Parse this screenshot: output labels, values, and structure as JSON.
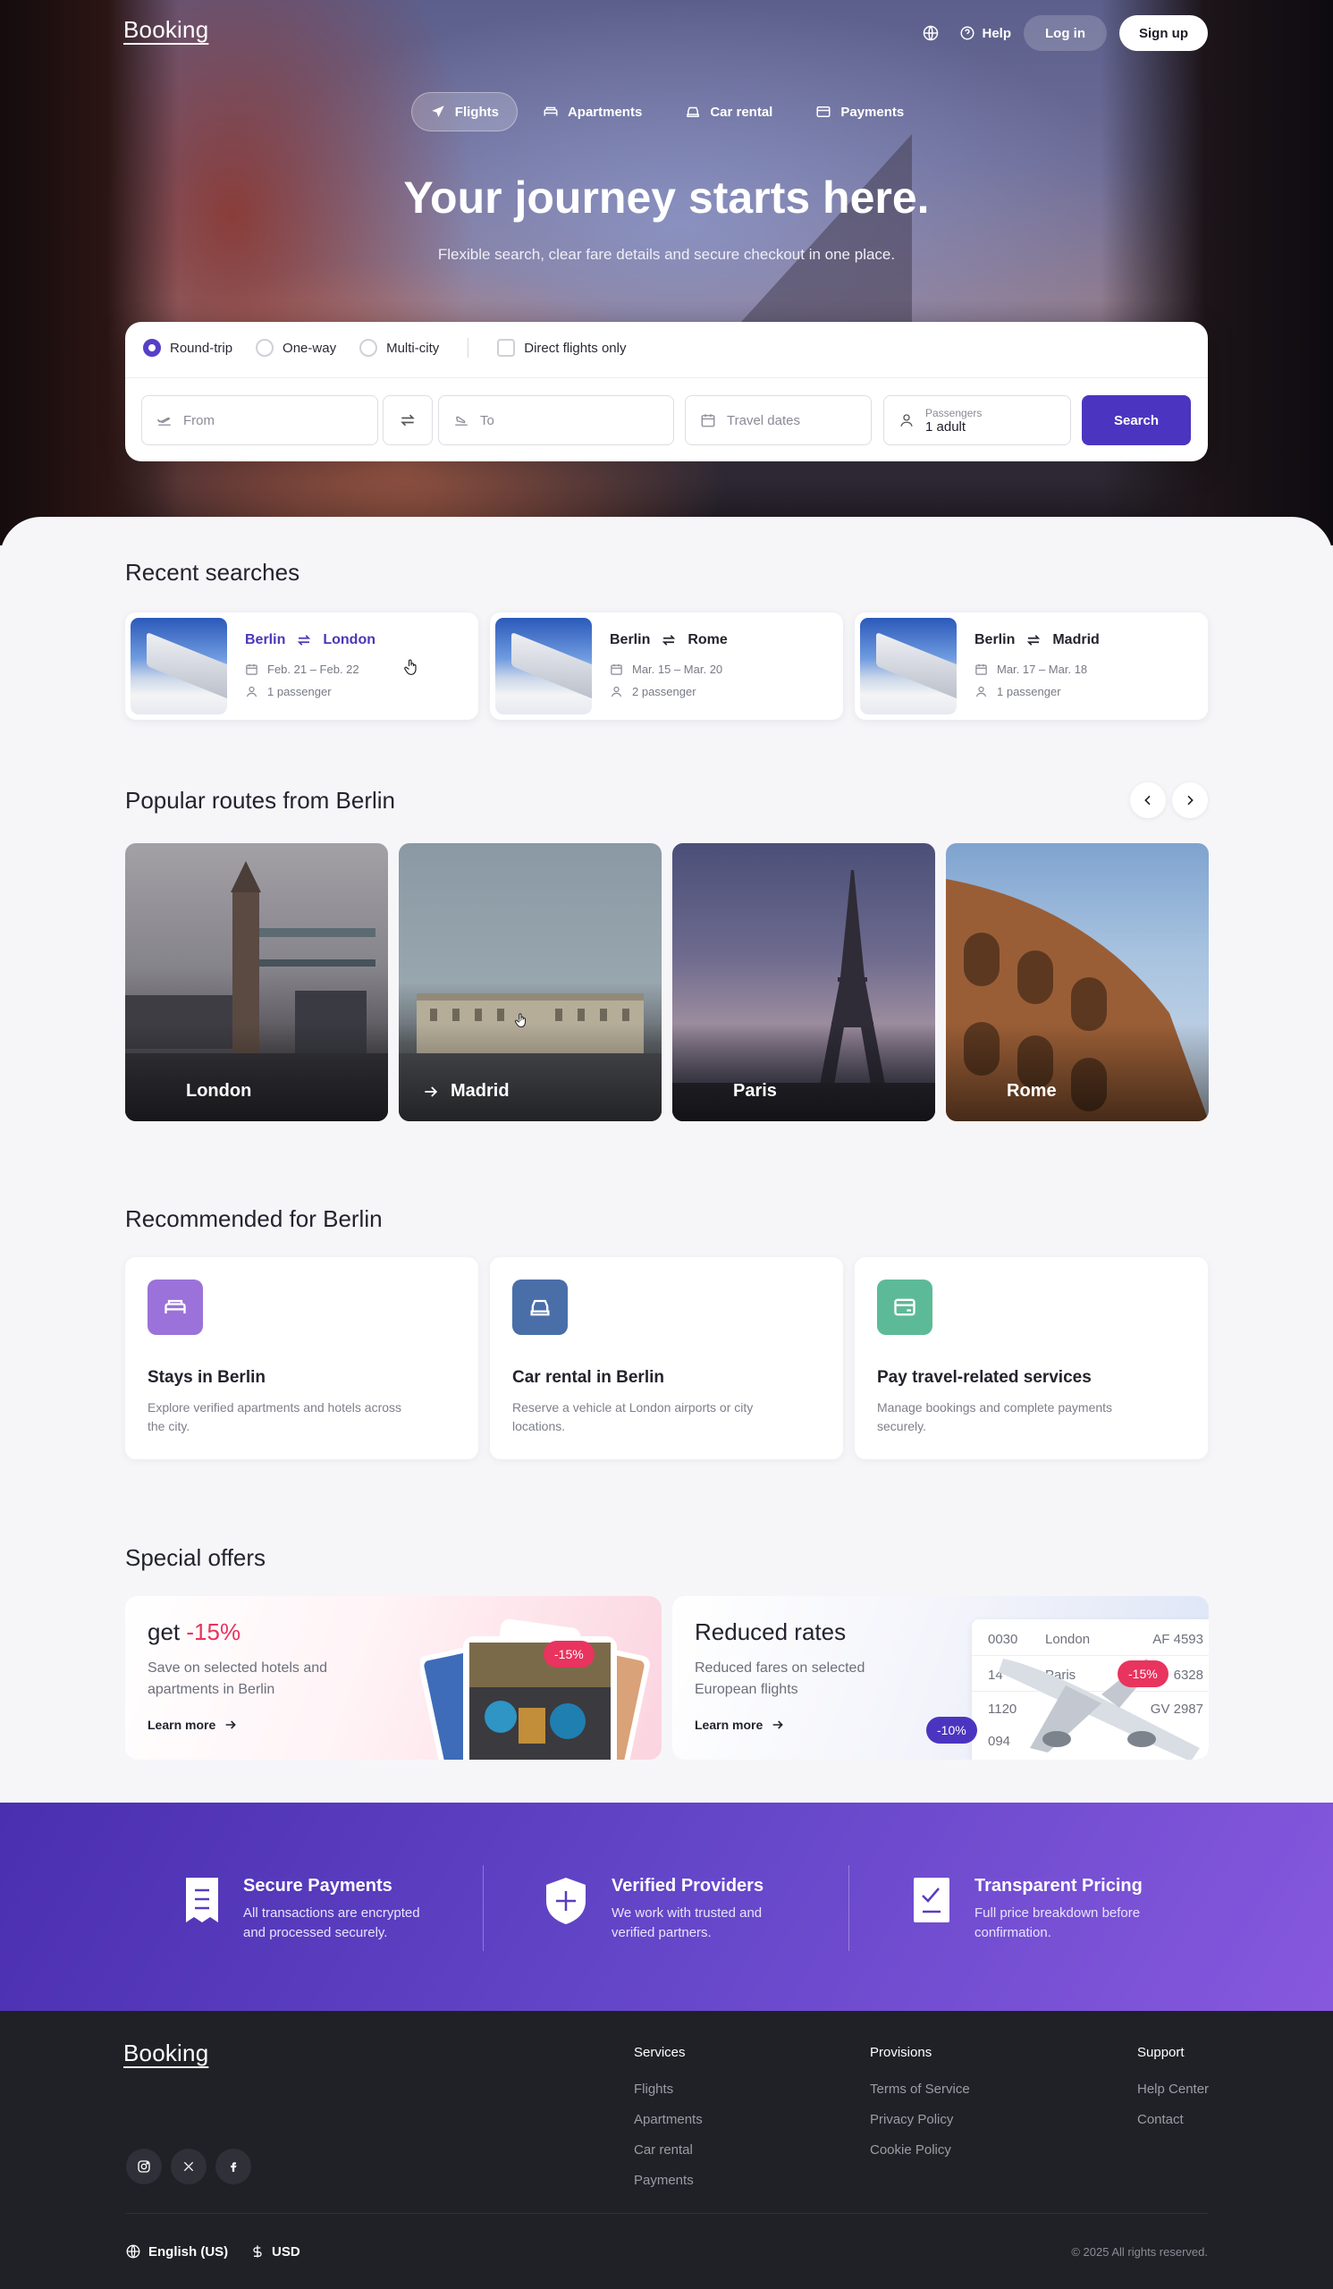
{
  "brand": "Booking",
  "topnav": {
    "globe_icon": "globe-icon",
    "help": "Help",
    "login": "Log in",
    "signup": "Sign up"
  },
  "tabs": [
    {
      "label": "Flights",
      "icon": "plane-icon"
    },
    {
      "label": "Apartments",
      "icon": "bed-icon"
    },
    {
      "label": "Car rental",
      "icon": "car-icon"
    },
    {
      "label": "Payments",
      "icon": "card-icon"
    }
  ],
  "hero": {
    "title": "Your journey starts here.",
    "subtitle": "Flexible search, clear fare details and secure checkout in one place."
  },
  "search": {
    "trip_types": [
      "Round-trip",
      "One-way",
      "Multi-city"
    ],
    "selected_trip": "Round-trip",
    "direct_only": "Direct flights only",
    "from_placeholder": "From",
    "to_placeholder": "To",
    "dates_placeholder": "Travel dates",
    "passengers_label": "Passengers",
    "passengers_value": "1 adult",
    "button": "Search"
  },
  "recent": {
    "title": "Recent searches",
    "items": [
      {
        "from": "Berlin",
        "to": "London",
        "dates": "Feb. 21 – Feb. 22",
        "pax": "1 passenger"
      },
      {
        "from": "Berlin",
        "to": "Rome",
        "dates": "Mar. 15 – Mar. 20",
        "pax": "2 passenger"
      },
      {
        "from": "Berlin",
        "to": "Madrid",
        "dates": "Mar. 17 – Mar. 18",
        "pax": "1 passenger"
      }
    ]
  },
  "popular": {
    "title": "Popular routes from Berlin",
    "routes": [
      "London",
      "Madrid",
      "Paris",
      "Rome"
    ]
  },
  "recommended": {
    "title": "Recommended for Berlin",
    "items": [
      {
        "title": "Stays in Berlin",
        "desc": "Explore verified apartments and hotels across the city.",
        "icon": "bed-icon",
        "color": "#9b72d9"
      },
      {
        "title": "Car rental in Berlin",
        "desc": "Reserve a vehicle at London airports or city locations.",
        "icon": "car-icon",
        "color": "#4a6ea8"
      },
      {
        "title": "Pay travel-related services",
        "desc": "Manage bookings and complete payments securely.",
        "icon": "card-icon",
        "color": "#5dba98"
      }
    ]
  },
  "offers": {
    "title": "Special offers",
    "items": [
      {
        "title_prefix": "get ",
        "title_pct": "-15%",
        "desc": "Save on selected hotels and apartments in Berlin",
        "link": "Learn more",
        "badges": [
          "-15%"
        ]
      },
      {
        "title": "Reduced rates",
        "desc": "Reduced fares on selected European flights",
        "link": "Learn more",
        "badges": [
          "-15%",
          "-10%"
        ],
        "board": [
          {
            "time": "0030",
            "city": "London",
            "flight": "AF 4593"
          },
          {
            "time": "14",
            "city": "Paris",
            "flight": "6328"
          },
          {
            "time": "1120",
            "city": "dam",
            "flight": "GV 2987"
          },
          {
            "time": "094",
            "city": "",
            "flight": ""
          }
        ]
      }
    ]
  },
  "trust": [
    {
      "title": "Secure Payments",
      "desc": "All transactions are encrypted and processed securely.",
      "icon": "receipt-icon"
    },
    {
      "title": "Verified Providers",
      "desc": "We work with trusted and verified partners.",
      "icon": "shield-icon"
    },
    {
      "title": "Transparent Pricing",
      "desc": "Full price breakdown before confirmation.",
      "icon": "checklist-icon"
    }
  ],
  "footer": {
    "columns": [
      {
        "title": "Services",
        "links": [
          "Flights",
          "Apartments",
          "Car rental",
          "Payments"
        ]
      },
      {
        "title": "Provisions",
        "links": [
          "Terms of Service",
          "Privacy Policy",
          "Cookie Policy"
        ]
      },
      {
        "title": "Support",
        "links": [
          "Help Center",
          "Contact"
        ]
      }
    ],
    "socials": [
      "instagram-icon",
      "x-icon",
      "facebook-icon"
    ],
    "language": "English (US)",
    "currency": "USD",
    "copyright": "© 2025 All rights reserved."
  }
}
